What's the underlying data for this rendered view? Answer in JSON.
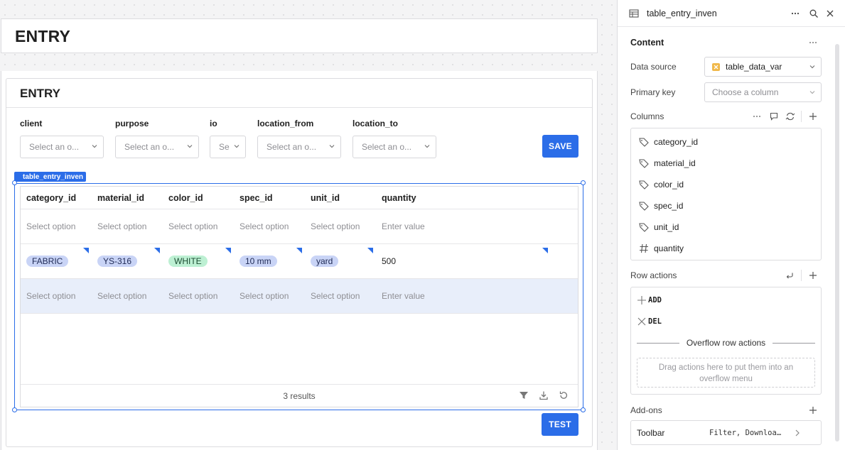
{
  "header": {
    "title": "ENTRY"
  },
  "card": {
    "title": "ENTRY"
  },
  "form": {
    "fields": [
      {
        "label": "client",
        "placeholder": "Select an o..."
      },
      {
        "label": "purpose",
        "placeholder": "Select an o..."
      },
      {
        "label": "io",
        "placeholder": "Se"
      },
      {
        "label": "location_from",
        "placeholder": "Select an o..."
      },
      {
        "label": "location_to",
        "placeholder": "Select an o..."
      }
    ],
    "save_label": "SAVE"
  },
  "selection": {
    "tag": "table_entry_inven"
  },
  "table": {
    "columns": [
      "category_id",
      "material_id",
      "color_id",
      "spec_id",
      "unit_id",
      "quantity"
    ],
    "placeholder_row": [
      "Select option",
      "Select option",
      "Select option",
      "Select option",
      "Select option",
      "Enter value"
    ],
    "data_row": [
      "FABRIC",
      "YS-316",
      "WHITE",
      "10 mm",
      "yard",
      "500"
    ],
    "new_row": [
      "Select option",
      "Select option",
      "Select option",
      "Select option",
      "Select option",
      "Enter value"
    ],
    "results": "3 results"
  },
  "test_label": "TEST",
  "colors": {
    "accent": "#2b6de8",
    "pill_blue": "#c9d4f6",
    "pill_green": "#bdf0d3",
    "row_highlight": "#e8eefa"
  },
  "panel": {
    "title": "table_entry_inven",
    "content_label": "Content",
    "data_source_label": "Data source",
    "data_source_value": "table_data_var",
    "primary_key_label": "Primary key",
    "primary_key_placeholder": "Choose a column",
    "columns_label": "Columns",
    "columns": [
      {
        "name": "category_id",
        "icon": "tag-icon"
      },
      {
        "name": "material_id",
        "icon": "tag-icon"
      },
      {
        "name": "color_id",
        "icon": "tag-icon"
      },
      {
        "name": "spec_id",
        "icon": "tag-icon"
      },
      {
        "name": "unit_id",
        "icon": "tag-icon"
      },
      {
        "name": "quantity",
        "icon": "hash-icon"
      }
    ],
    "row_actions_label": "Row actions",
    "row_actions": [
      "ADD",
      "DEL"
    ],
    "overflow_label": "Overflow row actions",
    "overflow_hint": "Drag actions here to put them into an overflow menu",
    "addons_label": "Add-ons",
    "toolbar_label": "Toolbar",
    "toolbar_value": "Filter, Downloa…"
  }
}
